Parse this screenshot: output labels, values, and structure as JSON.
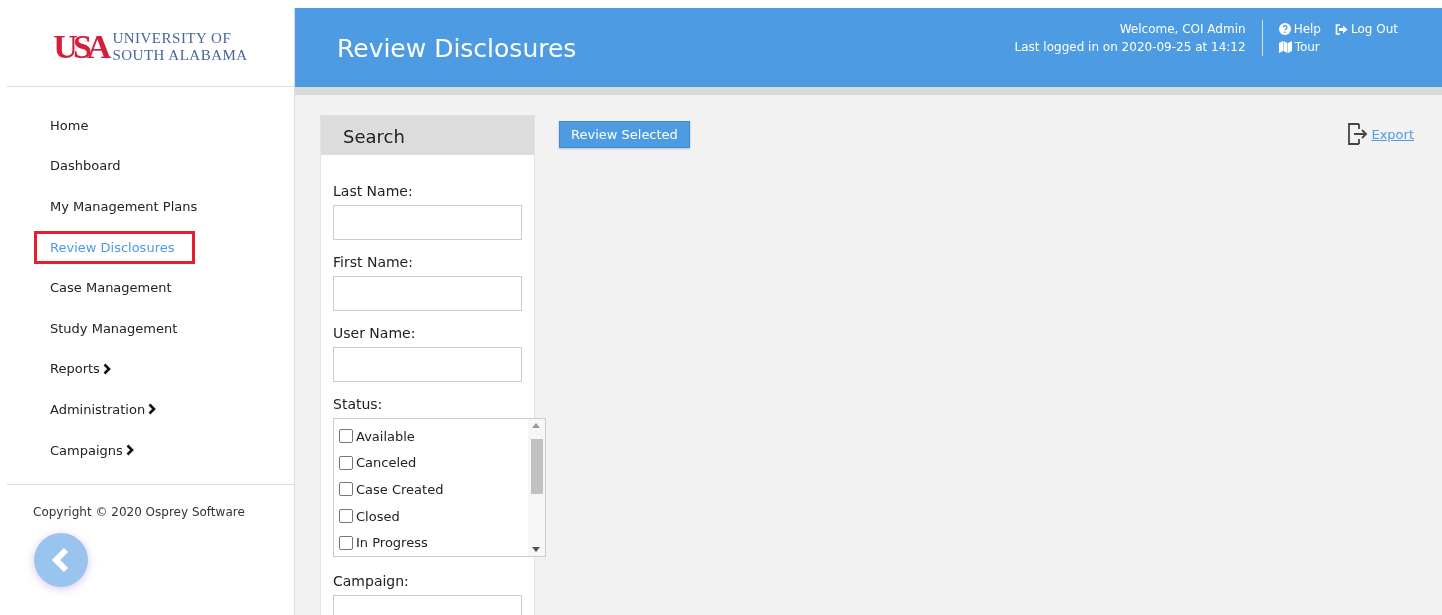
{
  "logo": {
    "mark": "USA",
    "line1": "UNIVERSITY OF",
    "line2": "SOUTH ALABAMA"
  },
  "header": {
    "title": "Review Disclosures",
    "welcome": "Welcome, COI Admin",
    "last_login": "Last logged in on 2020-09-25 at 14:12",
    "links": [
      {
        "label": "Help",
        "kind": "help"
      },
      {
        "label": "Log Out",
        "kind": "logout"
      },
      {
        "label": "Tour",
        "kind": "tour"
      }
    ]
  },
  "sidebar": {
    "items": [
      {
        "label": "Home",
        "selected": false,
        "expandable": false
      },
      {
        "label": "Dashboard",
        "selected": false,
        "expandable": false
      },
      {
        "label": "My Management Plans",
        "selected": false,
        "expandable": false
      },
      {
        "label": "Review Disclosures",
        "selected": true,
        "expandable": false
      },
      {
        "label": "Case Management",
        "selected": false,
        "expandable": false
      },
      {
        "label": "Study Management",
        "selected": false,
        "expandable": false
      },
      {
        "label": "Reports",
        "selected": false,
        "expandable": true
      },
      {
        "label": "Administration",
        "selected": false,
        "expandable": true
      },
      {
        "label": "Campaigns",
        "selected": false,
        "expandable": true
      }
    ],
    "copyright": "Copyright © 2020 Osprey Software"
  },
  "search": {
    "title": "Search",
    "fields": [
      {
        "label": "Last Name:"
      },
      {
        "label": "First Name:"
      },
      {
        "label": "User Name:"
      }
    ],
    "status_label": "Status:",
    "statuses": [
      {
        "label": "Available",
        "checked": false
      },
      {
        "label": "Canceled",
        "checked": false
      },
      {
        "label": "Case Created",
        "checked": false
      },
      {
        "label": "Closed",
        "checked": false
      },
      {
        "label": "In Progress",
        "checked": false
      }
    ],
    "campaign_label": "Campaign:"
  },
  "actions": {
    "review_button": "Review Selected",
    "export_link": "Export"
  }
}
